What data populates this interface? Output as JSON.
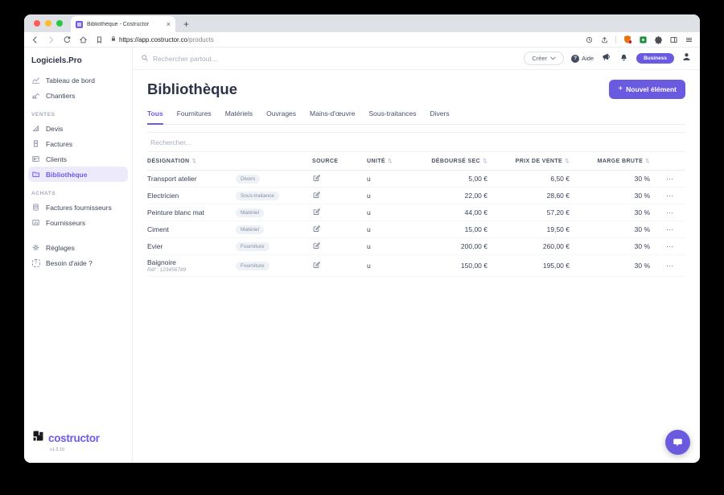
{
  "colors": {
    "accent": "#6C5CE7",
    "accent_light": "#ECEAFB",
    "badge_bg": "#EEF1F6",
    "plan_badge_bg": "#6A5AE0"
  },
  "icons": {
    "plus": "+",
    "more": "⋯",
    "sort": "⇅",
    "close_tab": "×",
    "new_tab": "+",
    "help_glyph": "?"
  },
  "browser": {
    "tab_title": "Bibliothèque - Costructor",
    "url_host": "https://app.costructor.co",
    "url_path": "/products"
  },
  "topbar": {
    "search_placeholder": "Rechercher partout...",
    "create_label": "Créer",
    "help_label": "Aide",
    "plan_badge": "Business"
  },
  "sidebar": {
    "brand": "Logiciels.Pro",
    "items": [
      {
        "label": "Tableau de bord",
        "icon": "dashboard-chart-icon"
      },
      {
        "label": "Chantiers",
        "icon": "excavator-icon"
      }
    ],
    "ventes_label": "Ventes",
    "ventes_items": [
      {
        "label": "Devis",
        "icon": "set-square-icon"
      },
      {
        "label": "Factures",
        "icon": "receipt-icon"
      },
      {
        "label": "Clients",
        "icon": "id-card-icon"
      },
      {
        "label": "Bibliothèque",
        "icon": "folder-icon",
        "active": true
      }
    ],
    "achats_label": "Achats",
    "achats_items": [
      {
        "label": "Factures fournisseurs",
        "icon": "receipt-grid-icon"
      },
      {
        "label": "Fournisseurs",
        "icon": "bar-chart-icon"
      }
    ],
    "bottom_items": [
      {
        "label": "Réglages",
        "icon": "gear-icon"
      },
      {
        "label": "Besoin d'aide ?",
        "icon": "dashed-question-icon"
      }
    ],
    "logo_text": "costructor",
    "version": "v1.2.10"
  },
  "page": {
    "title": "Bibliothèque",
    "new_button": "Nouvel élément",
    "tabs": [
      "Tous",
      "Fournitures",
      "Matériels",
      "Ouvrages",
      "Mains-d'œuvre",
      "Sous-traitances",
      "Divers"
    ],
    "active_tab": "Tous"
  },
  "table": {
    "search_placeholder": "Rechercher...",
    "headers": {
      "designation": "Désignation",
      "source": "Source",
      "unit": "Unité",
      "cost": "Déboursé sec",
      "price": "Prix de vente",
      "margin": "Marge brute"
    },
    "rows": [
      {
        "name": "Transport atelier",
        "category": "Divers",
        "unit": "u",
        "cost": "5,00 €",
        "price": "6,50 €",
        "margin": "30 %"
      },
      {
        "name": "Electricien",
        "category": "Sous-traitance",
        "unit": "u",
        "cost": "22,00 €",
        "price": "28,60 €",
        "margin": "30 %"
      },
      {
        "name": "Peinture blanc mat",
        "category": "Matériel",
        "unit": "u",
        "cost": "44,00 €",
        "price": "57,20 €",
        "margin": "30 %"
      },
      {
        "name": "Ciment",
        "category": "Matériel",
        "unit": "u",
        "cost": "15,00 €",
        "price": "19,50 €",
        "margin": "30 %"
      },
      {
        "name": "Evier",
        "category": "Fourniture",
        "unit": "u",
        "cost": "200,00 €",
        "price": "260,00 €",
        "margin": "30 %"
      },
      {
        "name": "Baignoire",
        "ref": "Réf : 123456789",
        "category": "Fourniture",
        "unit": "u",
        "cost": "150,00 €",
        "price": "195,00 €",
        "margin": "30 %"
      }
    ]
  }
}
